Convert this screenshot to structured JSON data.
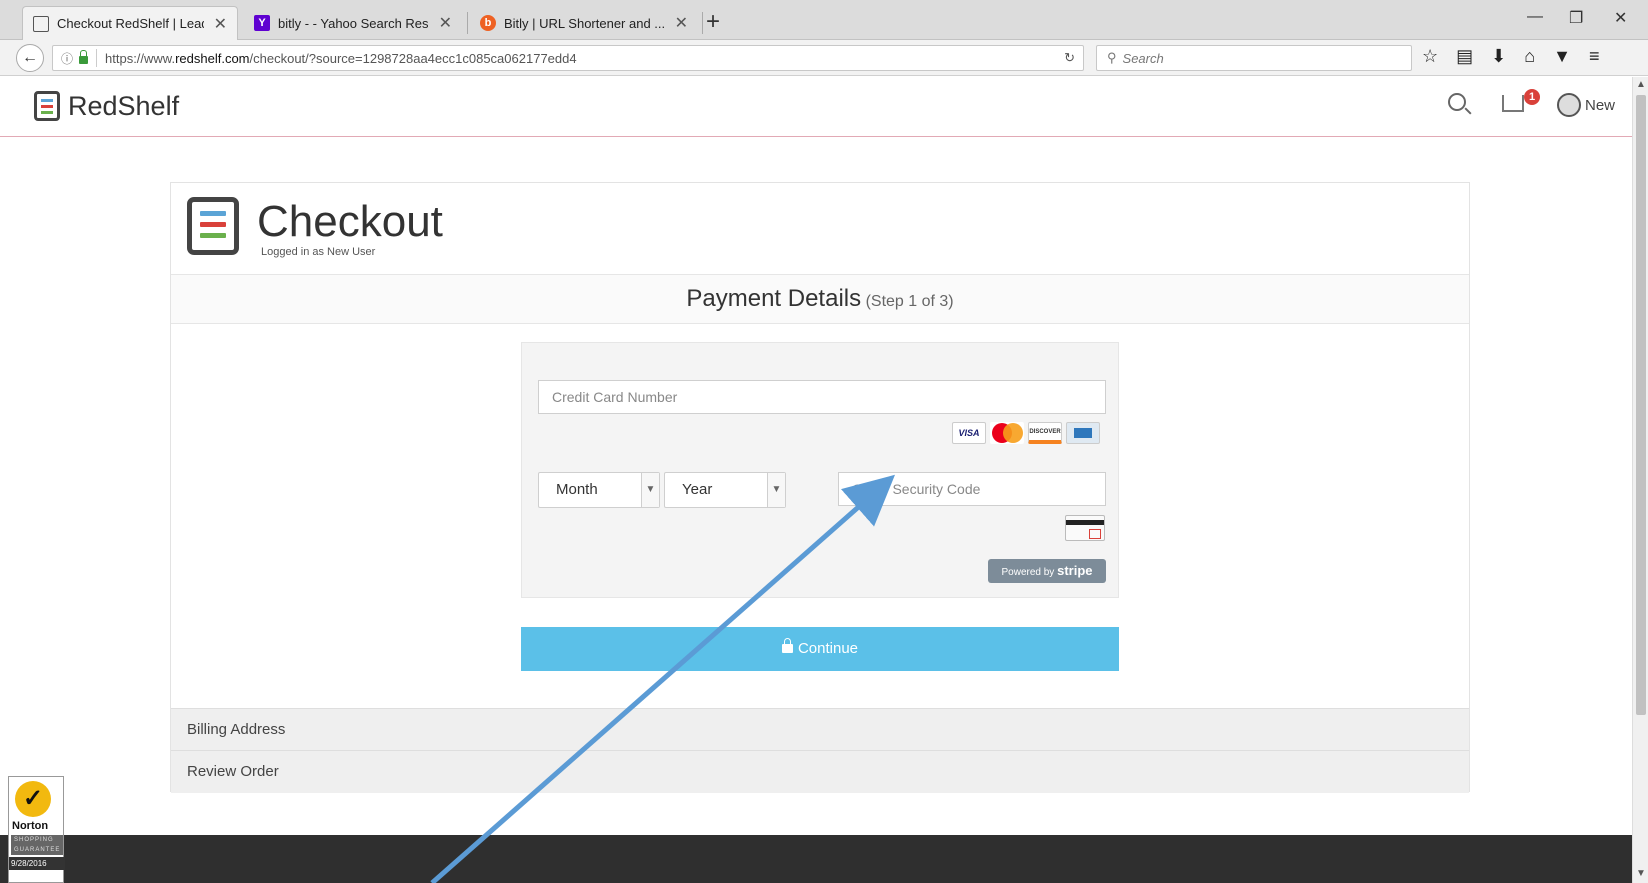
{
  "browser": {
    "tabs": [
      {
        "title": "Checkout RedShelf | Leadi...",
        "active": true,
        "favicon": "redshelf-favicon"
      },
      {
        "title": "bitly - - Yahoo Search Res...",
        "active": false,
        "favicon": "yahoo-favicon",
        "favicon_glyph": "Y"
      },
      {
        "title": "Bitly | URL Shortener and ...",
        "active": false,
        "favicon": "bitly-favicon",
        "favicon_glyph": "b"
      }
    ],
    "new_tab_glyph": "+",
    "tab_close_glyph": "✕",
    "url": {
      "prefix": "https://www.",
      "host": "redshelf.com",
      "path": "/checkout/?source=1298728aa4ecc1c085ca062177edd4"
    },
    "search_placeholder": "Search",
    "window_controls": [
      "—",
      "❐",
      "✕"
    ],
    "toolbar_icons": [
      "bookmark-star-icon",
      "reading-list-icon",
      "download-icon",
      "home-icon",
      "pocket-icon",
      "menu-icon"
    ],
    "toolbar_glyphs": [
      "☆",
      "▤",
      "⬇",
      "⌂",
      "▼",
      "≡"
    ]
  },
  "site_header": {
    "brand": "RedShelf",
    "cart_count": "1",
    "user_label": "New"
  },
  "checkout": {
    "title": "Checkout",
    "subtitle": "Logged in as New User",
    "payment_title": "Payment Details",
    "payment_step": "(Step 1 of 3)",
    "cc_placeholder": "Credit Card Number",
    "card_brands": [
      "VISA",
      "MasterCard",
      "DISCOVER",
      "AMEX"
    ],
    "month_label": "Month",
    "year_label": "Year",
    "cvv_placeholder": "CVV / Security Code",
    "powered_by": "Powered by",
    "stripe": "stripe",
    "continue_label": "Continue",
    "steps": [
      "Billing Address",
      "Review Order"
    ]
  },
  "norton": {
    "name": "Norton",
    "guarantee": "SHOPPING GUARANTEE",
    "date": "9/28/2016"
  },
  "colors": {
    "accent_continue": "#5bc0e8",
    "header_rule": "#e2a9b5",
    "badge_red": "#d9413a",
    "logo_stripe_blue": "#5ba4d6",
    "logo_stripe_red": "#d9413a",
    "logo_stripe_green": "#6ab04c",
    "annotation_arrow": "#5b9bd5"
  }
}
